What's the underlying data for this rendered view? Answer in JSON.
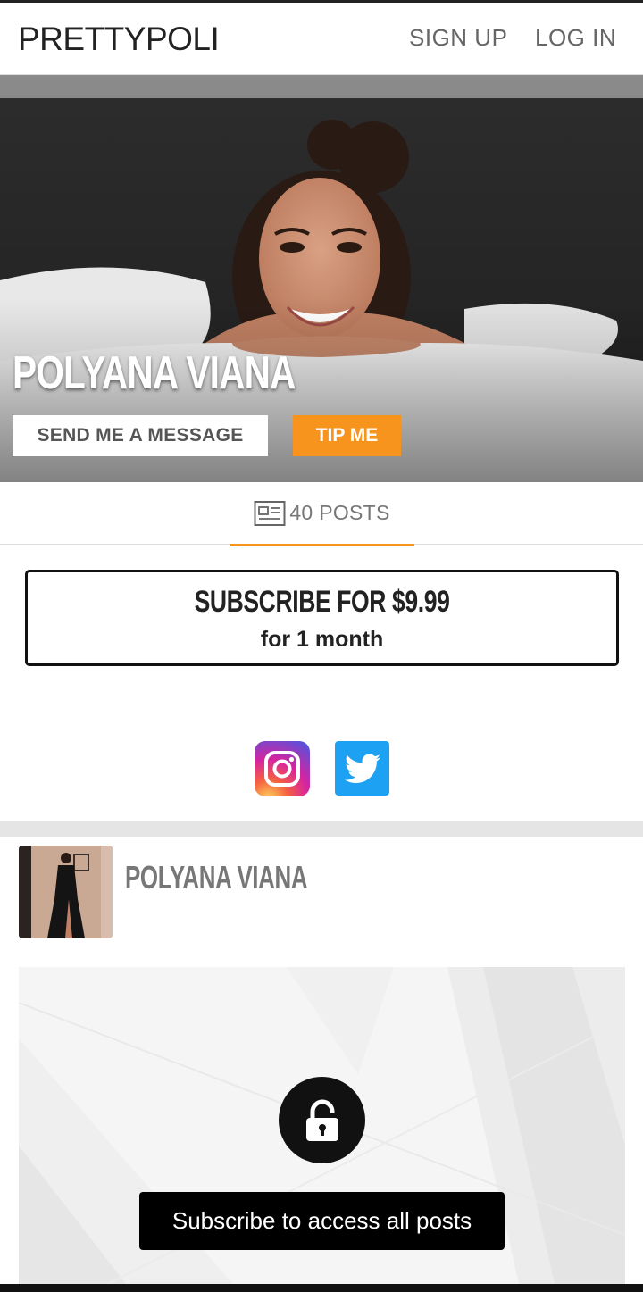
{
  "header": {
    "brand": "PRETTYPOLI",
    "signup_label": "SIGN UP",
    "login_label": "LOG IN"
  },
  "profile": {
    "name": "POLYANA VIANA",
    "message_button": "SEND ME A MESSAGE",
    "tip_button": "TIP ME"
  },
  "tabs": {
    "posts_label": "40 POSTS"
  },
  "subscription": {
    "title": "SUBSCRIBE FOR $9.99",
    "period": "for 1 month"
  },
  "social": {
    "icons": [
      "instagram-icon",
      "twitter-icon"
    ]
  },
  "post": {
    "author": "POLYANA VIANA",
    "lock_icon": "lock-icon",
    "cta": "Subscribe to access all posts"
  },
  "colors": {
    "accent": "#f7941d",
    "twitter": "#1da1f2"
  }
}
